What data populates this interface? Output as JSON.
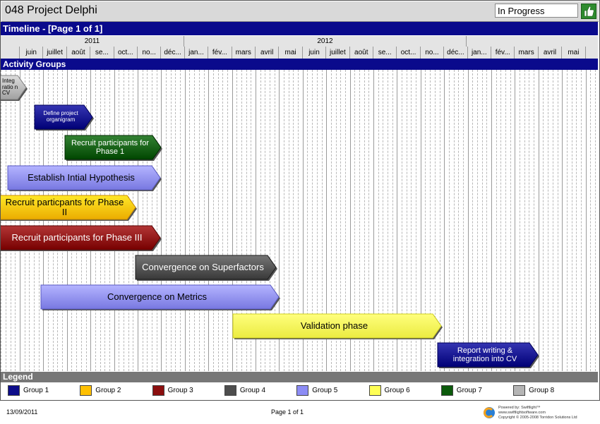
{
  "header": {
    "project_title": "048 Project Delphi",
    "status": "In Progress",
    "status_icon": "thumbs-up-icon"
  },
  "timeline_title": "Timeline - [Page 1 of 1]",
  "years": [
    "2011",
    "2012"
  ],
  "months": [
    "juin",
    "juillet",
    "août",
    "se...",
    "oct...",
    "no...",
    "déc...",
    "jan...",
    "fév...",
    "mars",
    "avril",
    "mai",
    "juin",
    "juillet",
    "août",
    "se...",
    "oct...",
    "no...",
    "déc...",
    "jan...",
    "fév...",
    "mars",
    "avril",
    "mai"
  ],
  "activity_groups_title": "Activity Groups",
  "tasks": [
    {
      "label": "Integ ratio n CV",
      "group": 8
    },
    {
      "label": "Define project organigram",
      "group": 1
    },
    {
      "label": "Recruit participants for Phase 1",
      "group": 7
    },
    {
      "label": "Establish Intial Hypothesis",
      "group": 5
    },
    {
      "label": "Recruit particpants for Phase II",
      "group": 2
    },
    {
      "label": "Recruit participants for Phase III",
      "group": 3
    },
    {
      "label": "Convergence on Superfactors",
      "group": 4
    },
    {
      "label": "Convergence on Metrics",
      "group": 5
    },
    {
      "label": "Validation phase",
      "group": 6
    },
    {
      "label": "Report writing & integration into CV",
      "group": 1
    }
  ],
  "legend_title": "Legend",
  "legend": [
    {
      "label": "Group 1",
      "color": "#0d0d8a"
    },
    {
      "label": "Group 2",
      "color": "#ffc000"
    },
    {
      "label": "Group 3",
      "color": "#8b0e0e"
    },
    {
      "label": "Group 4",
      "color": "#4d4d4d"
    },
    {
      "label": "Group 5",
      "color": "#8c8cf5"
    },
    {
      "label": "Group 6",
      "color": "#ffff55"
    },
    {
      "label": "Group 7",
      "color": "#0b5a0b"
    },
    {
      "label": "Group 8",
      "color": "#b5b5b5"
    }
  ],
  "footer": {
    "date": "13/09/2011",
    "page": "Page 1 of 1",
    "powered_lines": [
      "Powered by: Swiftlight™",
      "www.swiftlightsoftware.com",
      "Copyright © 2005-2008 Torridon Solutions Ltd"
    ]
  }
}
